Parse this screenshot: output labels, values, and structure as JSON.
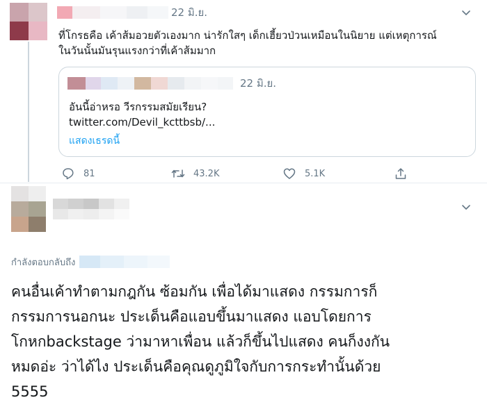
{
  "tweet": {
    "date": "22 มิ.ย.",
    "text_lines": [
      "ที่โกรธคือ เค้าส้มอวยตัวเองมาก น่ารักใสๆ เด็กเฮี้ยวป่วนเหมือนในนิยาย แต่เหตุการณ์",
      "ในวันนั้นมันรุนแรงกว่าที่เค้าส้มมาก"
    ],
    "quoted": {
      "date": "22 มิ.ย.",
      "text": "อันนี้อ่าหรอ วีรกรรมสมัยเรียน?",
      "link": "twitter.com/Devil_kcttbsb/...",
      "show_thread": "แสดงเธรดนี้"
    },
    "actions": {
      "reply_count": "81",
      "retweet_count": "43.2K",
      "like_count": "5.1K"
    }
  },
  "reply": {
    "replying_to_label": "กำลังตอบกลับถึง",
    "text_lines": [
      "คนอื่นเค้าทำตามกฎกัน ซ้อมกัน เพื่อได้มาแสดง กรรมการก็",
      "กรรมการนอกนะ ประเด็นคือแอบขึ้นมาแสดง แอบโดยการ",
      "โกหกbackstage ว่ามาหาเพื่อน แล้วก็ขึ้นไปแสดง คนก็งงกัน",
      "หมดอ่ะ ว่าได้ไง ประเด็นคือคุณดูภูมิใจกับการกระทำนั้นด้วย",
      "5555"
    ]
  },
  "colors": {
    "link": "#1da1f2",
    "muted": "#657786",
    "border": "#ccd6dd",
    "text": "#14171a"
  },
  "icons": [
    "chevron-down-icon",
    "reply-icon",
    "retweet-icon",
    "like-icon",
    "share-icon"
  ]
}
